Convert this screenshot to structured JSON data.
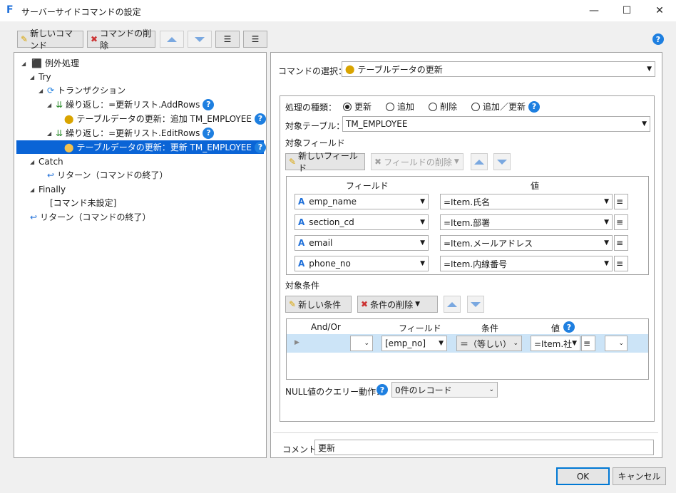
{
  "window": {
    "title": "サーバーサイドコマンドの設定",
    "app_icon": "F",
    "min": "—",
    "max": "☐",
    "close": "✕"
  },
  "toolbar": {
    "new_command": "新しいコマンド",
    "delete_command": "コマンドの削除",
    "help": "?"
  },
  "tree": {
    "exception": "例外処理",
    "try": "Try",
    "transaction": "トランザクション",
    "loop1": "繰り返し：=更新リスト.AddRows",
    "update_add": "テーブルデータの更新：追加 TM_EMPLOYEE",
    "loop2": "繰り返し：=更新リスト.EditRows",
    "update_upd": "テーブルデータの更新：更新 TM_EMPLOYEE",
    "catch": "Catch",
    "return1": "リターン（コマンドの終了）",
    "finally": "Finally",
    "unset": "[コマンド未設定]",
    "return2": "リターン（コマンドの終了）"
  },
  "command": {
    "label": "コマンドの選択：",
    "value": "テーブルデータの更新"
  },
  "process": {
    "label": "処理の種類：",
    "options": [
      "更新",
      "追加",
      "削除",
      "追加／更新"
    ],
    "selected": "更新"
  },
  "target_table": {
    "label": "対象テーブル：",
    "value": "TM_EMPLOYEE"
  },
  "fields": {
    "label": "対象フィールド",
    "new_btn": "新しいフィールド",
    "delete_btn": "フィールドの削除",
    "col_field": "フィールド",
    "col_value": "値",
    "rows": [
      {
        "field": "emp_name",
        "value": "=Item.氏名"
      },
      {
        "field": "section_cd",
        "value": "=Item.部署"
      },
      {
        "field": "email",
        "value": "=Item.メールアドレス"
      },
      {
        "field": "phone_no",
        "value": "=Item.内線番号"
      }
    ]
  },
  "conditions": {
    "label": "対象条件",
    "new_btn": "新しい条件",
    "delete_btn": "条件の削除",
    "cols": [
      "And/Or",
      "フィールド",
      "条件",
      "値"
    ],
    "row": {
      "field": "[emp_no]",
      "op": "＝（等しい）",
      "value": "=Item.社"
    }
  },
  "null_query": {
    "label": "NULL値のクエリー動作：",
    "value": "0件のレコード"
  },
  "comment": {
    "label": "コメント",
    "value": "更新"
  },
  "buttons": {
    "ok": "OK",
    "cancel": "キャンセル"
  }
}
